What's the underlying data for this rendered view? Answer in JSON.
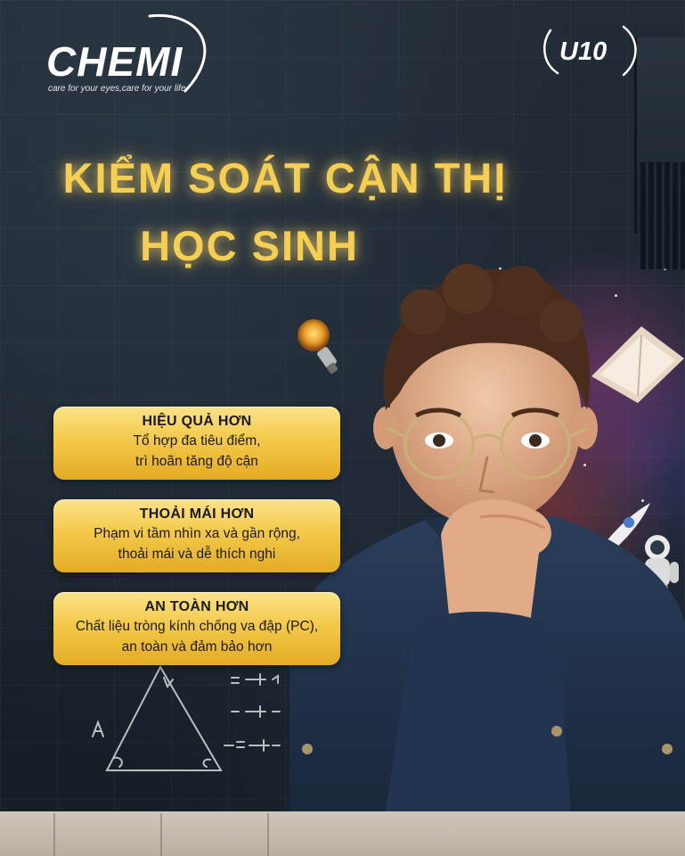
{
  "brand": {
    "name": "CHEMI",
    "tagline": "care for your eyes,care for your life",
    "badge": "U10"
  },
  "headline": {
    "line1": "KIỂM SOÁT CẬN  THỊ",
    "line2": "HỌC SINH"
  },
  "features": [
    {
      "title": "HIỆU QUẢ HƠN",
      "line1": "Tổ hợp đa tiêu điểm,",
      "line2": "trì hoãn tăng độ cận"
    },
    {
      "title": "THOẢI MÁI HƠN",
      "line1": "Phạm vi tầm nhìn xa và gần rộng,",
      "line2": "thoải mái và dễ thích nghi"
    },
    {
      "title": "AN TOÀN HƠN",
      "line1": "Chất liệu tròng kính chống va đập (PC),",
      "line2": "an toàn và đảm bảo hơn"
    }
  ],
  "colors": {
    "headline": "#f4cf52",
    "card_gold": "#f3c94a",
    "background": "#1c2630"
  },
  "icons": [
    "light-bulb-icon",
    "rocket-icon",
    "astronaut-icon",
    "paper-plane-icon",
    "book-icon"
  ]
}
